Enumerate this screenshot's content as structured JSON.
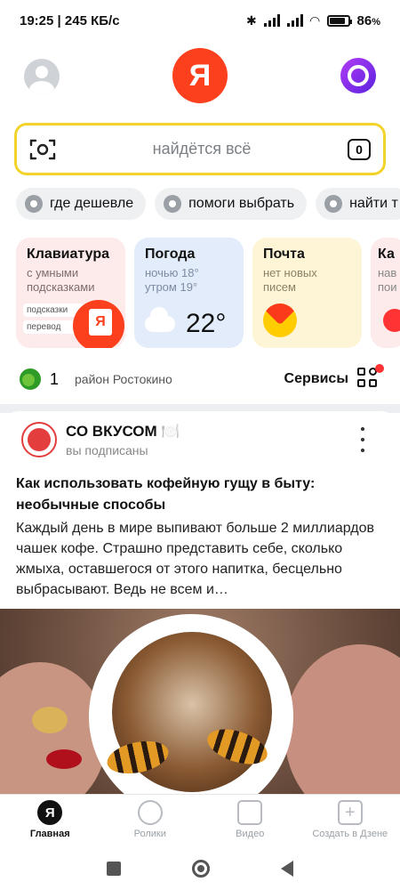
{
  "status_bar": {
    "time": "19:25",
    "speed": "245 КБ/с",
    "battery": "86"
  },
  "search": {
    "placeholder": "найдётся всё",
    "tabs_count": "0"
  },
  "chips": [
    "где дешевле",
    "помоги выбрать",
    "найти т"
  ],
  "cards": {
    "keyboard": {
      "title": "Клавиатура",
      "subtitle": "с умными подсказками",
      "tags": [
        "подсказки",
        "перевод"
      ]
    },
    "weather": {
      "title": "Погода",
      "line1": "ночью 18°",
      "line2": "утром 19°",
      "temp": "22°"
    },
    "mail": {
      "title": "Почта",
      "subtitle": "нет новых писем"
    },
    "maps": {
      "title": "Ка",
      "subtitle": "нав пои"
    }
  },
  "info_row": {
    "aqi_value": "1",
    "district": "район Ростокино",
    "services_label": "Сервисы"
  },
  "feed_card": {
    "channel_name": "СО ВКУСОМ 🍽️",
    "channel_status": "вы подписаны",
    "title": "Как использовать кофейную гущу в быту: необычные способы",
    "body": "Каждый день в мире выпивают больше 2 миллиардов чашек кофе. Страшно представить себе, сколько жмыха, оставшегося от этого напитка, бесцельно выбрасывают. Ведь не всем и…"
  },
  "bottom_nav": {
    "items": [
      {
        "label": "Главная",
        "icon": "yandex-icon",
        "active": true
      },
      {
        "label": "Ролики",
        "icon": "clips-icon",
        "active": false
      },
      {
        "label": "Видео",
        "icon": "video-icon",
        "active": false
      },
      {
        "label": "Создать в Дзене",
        "icon": "plus-icon",
        "active": false
      }
    ]
  },
  "colors": {
    "accent_red": "#fc3f1d",
    "search_border": "#f2d32c",
    "alice_purple": "#7b2ff0"
  }
}
